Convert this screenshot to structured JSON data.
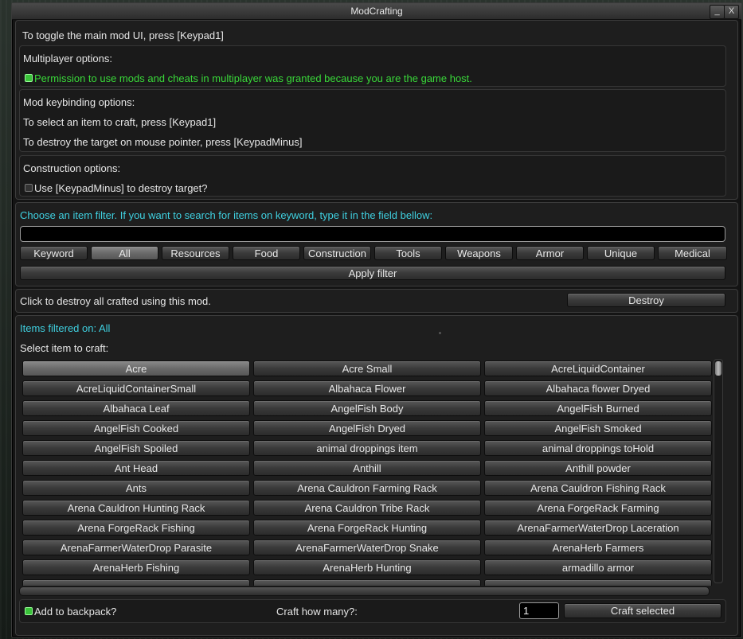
{
  "window": {
    "title": "ModCrafting",
    "minimize_label": "_",
    "close_label": "X"
  },
  "info": {
    "toggle_text": "To toggle the main mod UI, press [Keypad1]",
    "multiplayer": {
      "heading": "Multiplayer options:",
      "permission_text": "Permission to use mods and cheats in multiplayer was granted because you are the game host.",
      "permission_checked": true
    },
    "keybinding": {
      "heading": "Mod keybinding options:",
      "select_text": "To select an item to craft, press [Keypad1]",
      "destroy_text": "To destroy the target on mouse pointer, press [KeypadMinus]"
    },
    "construction": {
      "heading": "Construction options:",
      "option_text": "Use [KeypadMinus] to destroy target?",
      "option_checked": false
    }
  },
  "filter": {
    "instruction": "Choose an item filter. If you want to search for items on keyword, type it in the field bellow:",
    "keyword_value": "",
    "buttons": [
      "Keyword",
      "All",
      "Resources",
      "Food",
      "Construction",
      "Tools",
      "Weapons",
      "Armor",
      "Unique",
      "Medical"
    ],
    "active_button": "All",
    "apply_label": "Apply filter"
  },
  "destroy": {
    "text": "Click to destroy all crafted using this mod.",
    "button_label": "Destroy"
  },
  "items": {
    "filtered_text": "Items filtered on: All",
    "select_text": "Select item to craft:",
    "selected": "Acre",
    "list": [
      "Acre",
      "Acre Small",
      "AcreLiquidContainer",
      "AcreLiquidContainerSmall",
      "Albahaca Flower",
      "Albahaca flower Dryed",
      "Albahaca Leaf",
      "AngelFish Body",
      "AngelFish Burned",
      "AngelFish Cooked",
      "AngelFish Dryed",
      "AngelFish Smoked",
      "AngelFish Spoiled",
      "animal droppings item",
      "animal droppings toHold",
      "Ant Head",
      "Anthill",
      "Anthill powder",
      "Ants",
      "Arena Cauldron Farming Rack",
      "Arena Cauldron Fishing Rack",
      "Arena Cauldron Hunting Rack",
      "Arena Cauldron Tribe Rack",
      "Arena ForgeRack Farming",
      "Arena ForgeRack Fishing",
      "Arena ForgeRack Hunting",
      "ArenaFarmerWaterDrop Laceration",
      "ArenaFarmerWaterDrop Parasite",
      "ArenaFarmerWaterDrop Snake",
      "ArenaHerb Farmers",
      "ArenaHerb Fishing",
      "ArenaHerb Hunting",
      "armadillo armor",
      "",
      "",
      ""
    ]
  },
  "footer": {
    "backpack_text": "Add to backpack?",
    "backpack_checked": true,
    "quantity_label": "Craft how many?:",
    "quantity_value": "1",
    "craft_label": "Craft selected"
  }
}
